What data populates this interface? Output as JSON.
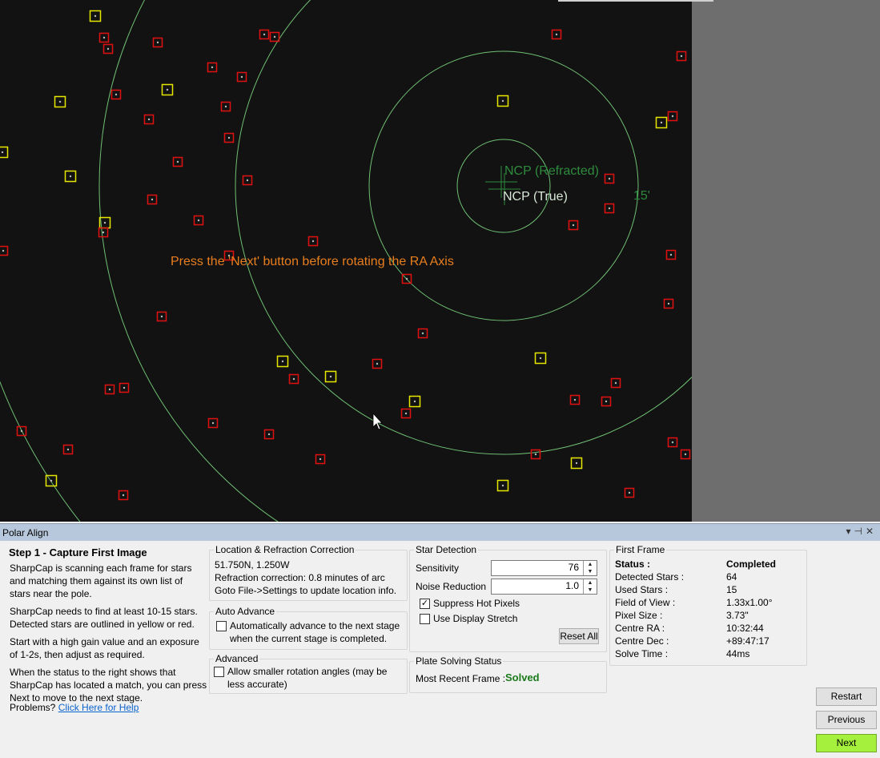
{
  "viewer": {
    "instruction": "Press the 'Next' button before rotating the RA Axis",
    "ncp_refracted_label": "NCP (Refracted)",
    "ncp_true_label": "NCP (True)",
    "ring_label": "15'",
    "colors": {
      "background": "#121212",
      "ring": "#6fbf73",
      "yellow_star": "#e6e600",
      "red_star": "#e01010",
      "instruction": "#e87e1e",
      "ncp_label": "#2e8b3e"
    }
  },
  "panel": {
    "title": "Polar Align",
    "title_buttons": [
      "chevron-down-icon",
      "pin-icon",
      "close-icon"
    ],
    "step": {
      "heading": "Step 1 - Capture First Image",
      "paragraphs": [
        [
          "SharpCap is scanning each frame for stars",
          "and matching them against its own list of",
          "stars near the pole."
        ],
        [
          "SharpCap needs to find at least 10-15 stars.",
          "Detected stars are outlined in yellow or red."
        ],
        [
          "Start with a high gain value and an exposure",
          "of 1-2s, then adjust as required."
        ],
        [
          "When the status to the right shows that",
          "SharpCap has located a match, you can press",
          "Next to move to the next stage."
        ]
      ],
      "problems_label": "Problems?",
      "help_link": "Click Here for Help"
    },
    "location": {
      "title": "Location & Refraction Correction",
      "coords": "51.750N, 1.250W",
      "refraction": "Refraction correction: 0.8 minutes of arc",
      "goto": "Goto File->Settings to update location info."
    },
    "auto_advance": {
      "title": "Auto Advance",
      "checked": false,
      "line1": "Automatically advance to the next stage",
      "line2": "when the current stage is completed."
    },
    "advanced": {
      "title": "Advanced",
      "checked": false,
      "line1": "Allow smaller rotation angles (may be",
      "line2": "less accurate)"
    },
    "star_detection": {
      "title": "Star Detection",
      "sensitivity_label": "Sensitivity",
      "sensitivity_value": "76",
      "noise_label": "Noise Reduction",
      "noise_value": "1.0",
      "suppress_label": "Suppress Hot Pixels",
      "suppress_checked": true,
      "stretch_label": "Use Display Stretch",
      "stretch_checked": false,
      "reset_label": "Reset All"
    },
    "plate_solving": {
      "title": "Plate Solving Status",
      "label": "Most Recent Frame :",
      "status": "Solved",
      "status_color": "#1a7a1a"
    },
    "first_frame": {
      "title": "First Frame",
      "rows": [
        {
          "label": "Status :",
          "value": "Completed",
          "bold": true
        },
        {
          "label": "Detected Stars :",
          "value": "64"
        },
        {
          "label": "Used Stars :",
          "value": "15"
        },
        {
          "label": "Field of View :",
          "value": "1.33x1.00°"
        },
        {
          "label": "Pixel Size :",
          "value": "3.73\""
        },
        {
          "label": "Centre RA :",
          "value": "10:32:44"
        },
        {
          "label": "Centre Dec :",
          "value": "+89:47:17"
        },
        {
          "label": "Solve Time :",
          "value": "44ms"
        }
      ]
    },
    "buttons": {
      "restart": "Restart",
      "previous": "Previous",
      "next": "Next"
    }
  }
}
